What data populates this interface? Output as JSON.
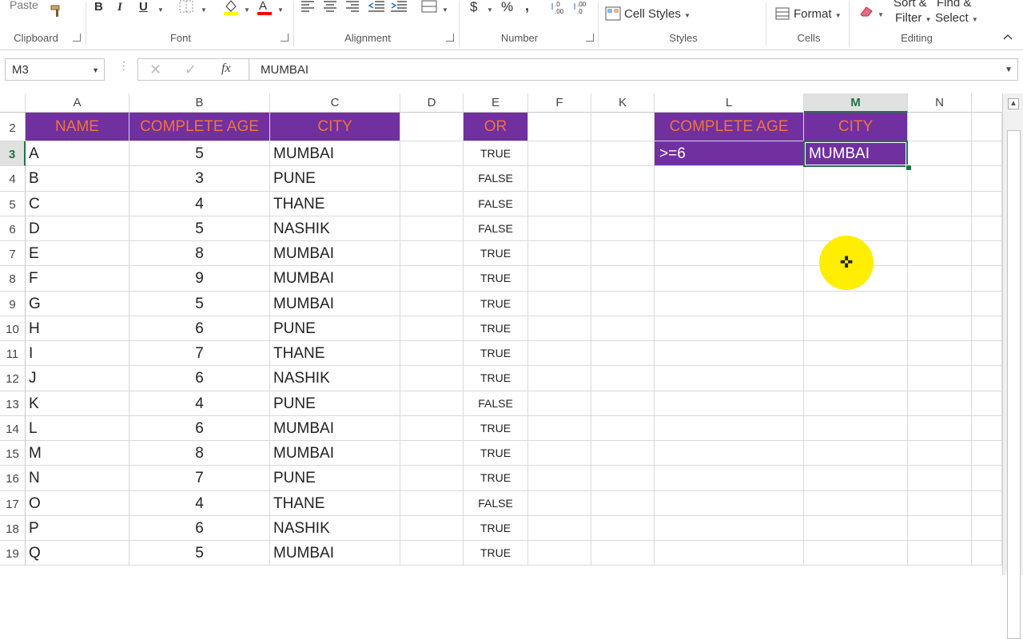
{
  "ribbon": {
    "paste_label": "Paste",
    "groups": {
      "clipboard": "Clipboard",
      "font": "Font",
      "alignment": "Alignment",
      "number": "Number",
      "styles": "Styles",
      "cells": "Cells",
      "editing": "Editing"
    },
    "bold": "B",
    "italic": "I",
    "underline": "U",
    "currency": "$",
    "percent": "%",
    "comma": ",",
    "cell_styles": "Cell Styles",
    "format": "Format",
    "sort_filter_line1": "Sort &",
    "sort_filter_line2": "Filter",
    "find_select_line1": "Find &",
    "find_select_line2": "Select"
  },
  "formula_bar": {
    "name_box": "M3",
    "fx": "fx",
    "value": "MUMBAI"
  },
  "columns": [
    "A",
    "B",
    "C",
    "D",
    "E",
    "F",
    "K",
    "L",
    "M",
    "N"
  ],
  "selected_column": "M",
  "selected_row": "3",
  "header_row": {
    "row_number": "2",
    "name": "NAME",
    "age": "COMPLETE AGE",
    "city": "CITY",
    "or": "OR",
    "crit_age": "COMPLETE AGE",
    "crit_city": "CITY"
  },
  "criteria": {
    "age": ">=6",
    "city": "MUMBAI"
  },
  "rows": [
    {
      "r": "3",
      "name": "A",
      "age": "5",
      "city": "MUMBAI",
      "or": "TRUE"
    },
    {
      "r": "4",
      "name": "B",
      "age": "3",
      "city": "PUNE",
      "or": "FALSE"
    },
    {
      "r": "5",
      "name": "C",
      "age": "4",
      "city": "THANE",
      "or": "FALSE"
    },
    {
      "r": "6",
      "name": "D",
      "age": "5",
      "city": "NASHIK",
      "or": "FALSE"
    },
    {
      "r": "7",
      "name": "E",
      "age": "8",
      "city": "MUMBAI",
      "or": "TRUE"
    },
    {
      "r": "8",
      "name": "F",
      "age": "9",
      "city": "MUMBAI",
      "or": "TRUE"
    },
    {
      "r": "9",
      "name": "G",
      "age": "5",
      "city": "MUMBAI",
      "or": "TRUE"
    },
    {
      "r": "10",
      "name": "H",
      "age": "6",
      "city": "PUNE",
      "or": "TRUE"
    },
    {
      "r": "11",
      "name": "I",
      "age": "7",
      "city": "THANE",
      "or": "TRUE"
    },
    {
      "r": "12",
      "name": "J",
      "age": "6",
      "city": "NASHIK",
      "or": "TRUE"
    },
    {
      "r": "13",
      "name": "K",
      "age": "4",
      "city": "PUNE",
      "or": "FALSE"
    },
    {
      "r": "14",
      "name": "L",
      "age": "6",
      "city": "MUMBAI",
      "or": "TRUE"
    },
    {
      "r": "15",
      "name": "M",
      "age": "8",
      "city": "MUMBAI",
      "or": "TRUE"
    },
    {
      "r": "16",
      "name": "N",
      "age": "7",
      "city": "PUNE",
      "or": "TRUE"
    },
    {
      "r": "17",
      "name": "O",
      "age": "4",
      "city": "THANE",
      "or": "FALSE"
    },
    {
      "r": "18",
      "name": "P",
      "age": "6",
      "city": "NASHIK",
      "or": "TRUE"
    },
    {
      "r": "19",
      "name": "Q",
      "age": "5",
      "city": "MUMBAI",
      "or": "TRUE"
    }
  ],
  "colors": {
    "header_fill": "#7030a0",
    "header_text": "#f4733a",
    "selection": "#217346",
    "cursor_highlight": "#ffee00"
  }
}
